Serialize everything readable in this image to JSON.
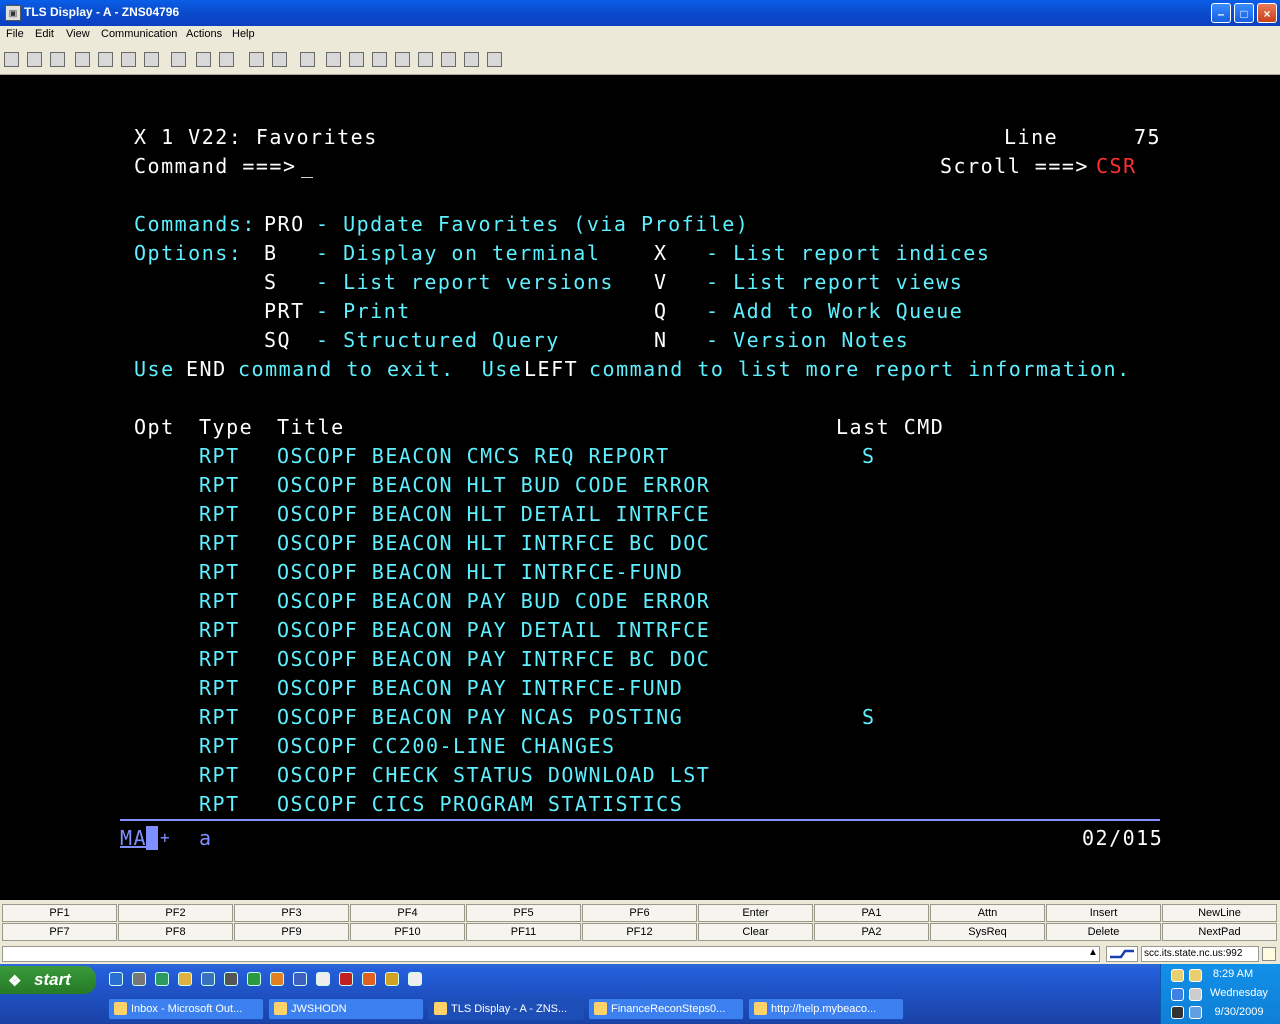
{
  "window": {
    "title": "TLS Display - A - ZNS04796",
    "min_glyph": "–",
    "max_glyph": "□",
    "close_glyph": "×"
  },
  "menu": [
    "File",
    "Edit",
    "View",
    "Communication",
    "Actions",
    "Help"
  ],
  "toolbar_icons": [
    "new-session-icon",
    "open-icon",
    "disconnect-icon",
    "send-icon",
    "receive-icon",
    "copy-icon",
    "paste-icon",
    "print-icon",
    "tools-icon",
    "grid-icon",
    "transfer-icon",
    "macro-icon",
    "help-icon",
    "screen-icon",
    "keyboard-icon",
    "display-icon",
    "download-icon",
    "upload-icon",
    "settings-icon",
    "stop-icon",
    "notes-icon"
  ],
  "screen": {
    "header_left": "X 1 V22: Favorites",
    "line_label": "Line",
    "line_value": "75",
    "command_label": "Command ===>",
    "command_value": "_",
    "scroll_label": "Scroll ===>",
    "scroll_value": "CSR",
    "commands_label": "Commands:",
    "commands_pro": "PRO",
    "commands_desc": "- Update Favorites (via Profile)",
    "options_label": "Options:",
    "options": [
      {
        "code": "B",
        "desc": "- Display on terminal",
        "code2": "X",
        "desc2": "- List report indices"
      },
      {
        "code": "S",
        "desc": "- List report versions",
        "code2": "V",
        "desc2": "- List report views"
      },
      {
        "code": "PRT",
        "desc": "- Print",
        "code2": "Q",
        "desc2": "- Add to Work Queue"
      },
      {
        "code": "SQ",
        "desc": "- Structured Query",
        "code2": "N",
        "desc2": "- Version Notes"
      }
    ],
    "help_use": "Use",
    "help_end": "END",
    "help_mid": "command to exit.  Use",
    "help_left": "LEFT",
    "help_tail": "command to list more report information.",
    "col_opt": "Opt",
    "col_type": "Type",
    "col_title": "Title",
    "col_last": "Last CMD",
    "rows": [
      {
        "type": "RPT",
        "title": "OSCOPF BEACON CMCS REQ REPORT",
        "last": "S"
      },
      {
        "type": "RPT",
        "title": "OSCOPF BEACON HLT BUD CODE ERROR",
        "last": ""
      },
      {
        "type": "RPT",
        "title": "OSCOPF BEACON HLT DETAIL INTRFCE",
        "last": ""
      },
      {
        "type": "RPT",
        "title": "OSCOPF BEACON HLT INTRFCE BC DOC",
        "last": ""
      },
      {
        "type": "RPT",
        "title": "OSCOPF BEACON HLT INTRFCE-FUND",
        "last": ""
      },
      {
        "type": "RPT",
        "title": "OSCOPF BEACON PAY BUD CODE ERROR",
        "last": ""
      },
      {
        "type": "RPT",
        "title": "OSCOPF BEACON PAY DETAIL INTRFCE",
        "last": ""
      },
      {
        "type": "RPT",
        "title": "OSCOPF BEACON PAY INTRFCE BC DOC",
        "last": ""
      },
      {
        "type": "RPT",
        "title": "OSCOPF BEACON PAY INTRFCE-FUND",
        "last": ""
      },
      {
        "type": "RPT",
        "title": "OSCOPF BEACON PAY NCAS POSTING",
        "last": "S"
      },
      {
        "type": "RPT",
        "title": "OSCOPF CC200-LINE CHANGES",
        "last": ""
      },
      {
        "type": "RPT",
        "title": "OSCOPF CHECK STATUS DOWNLOAD LST",
        "last": ""
      },
      {
        "type": "RPT",
        "title": "OSCOPF CICS PROGRAM STATISTICS",
        "last": ""
      }
    ],
    "oia_ma": "MA",
    "oia_plus": "+",
    "oia_a": "a",
    "oia_pos": "02/015"
  },
  "pf_row1": [
    "PF1",
    "PF2",
    "PF3",
    "PF4",
    "PF5",
    "PF6",
    "Enter",
    "PA1",
    "Attn",
    "Insert",
    "NewLine"
  ],
  "pf_row2": [
    "PF7",
    "PF8",
    "PF9",
    "PF10",
    "PF11",
    "PF12",
    "Clear",
    "PA2",
    "SysReq",
    "Delete",
    "NextPad"
  ],
  "status": {
    "host": "scc.its.state.nc.us:992",
    "arrow": "▲"
  },
  "taskbar": {
    "start": "start",
    "tasks": [
      {
        "label": "Inbox - Microsoft Out..."
      },
      {
        "label": "JWSHODN"
      },
      {
        "label": "TLS Display - A - ZNS..."
      },
      {
        "label": "FinanceReconSteps0..."
      },
      {
        "label": "http://help.mybeaco..."
      }
    ],
    "clock_time": "8:29 AM",
    "clock_day": "Wednesday",
    "clock_date": "9/30/2009"
  },
  "colors": {
    "terminal_cyan": "#5ff0ff",
    "terminal_white": "#ffffff",
    "terminal_red": "#ff3030",
    "terminal_blue": "#7f8fff"
  }
}
